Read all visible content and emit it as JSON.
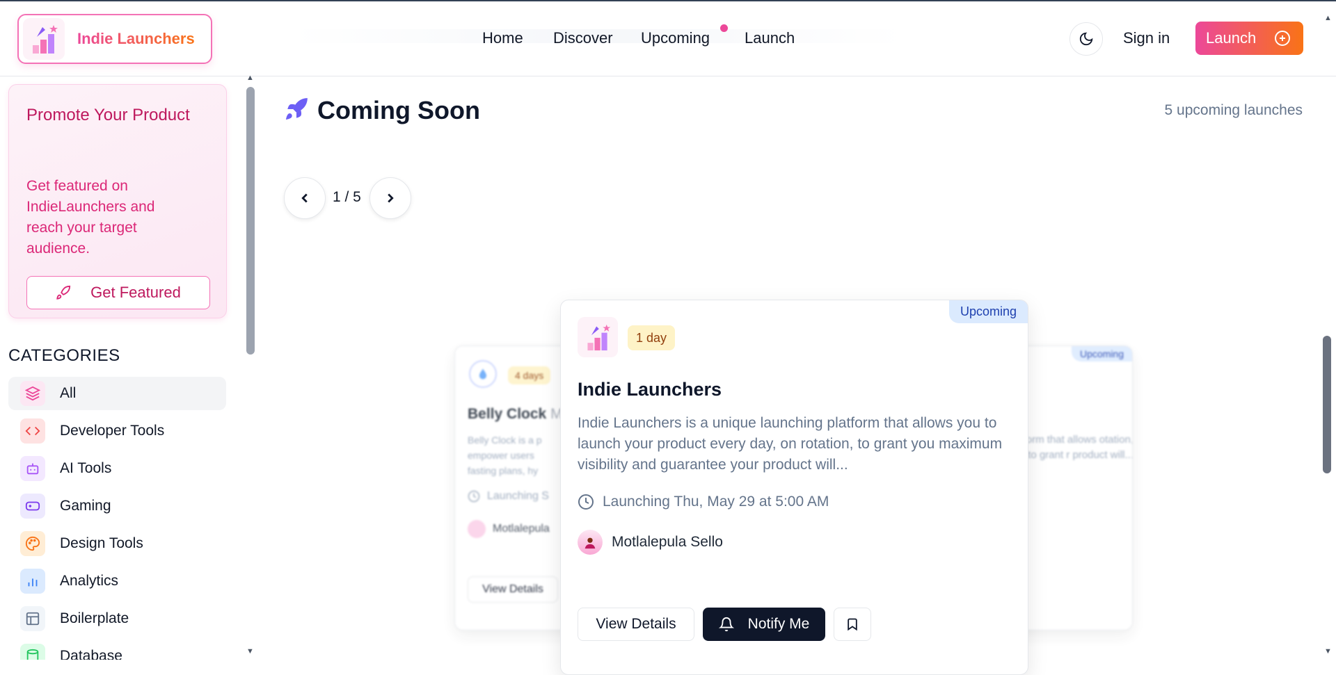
{
  "header": {
    "brand": "Indie Launchers",
    "nav": [
      "Home",
      "Discover",
      "Upcoming",
      "Launch"
    ],
    "sign_in": "Sign in",
    "launch_button": "Launch"
  },
  "sidebar": {
    "promo_title": "Promote Your Product",
    "promo_description": "Get featured on IndieLaunchers and reach your target audience.",
    "promo_button": "Get Featured",
    "categories_title": "CATEGORIES",
    "categories": [
      {
        "label": "All",
        "icon": "layers-icon",
        "color": "#ec4899"
      },
      {
        "label": "Developer Tools",
        "icon": "code-icon",
        "color": "#ef4444"
      },
      {
        "label": "AI Tools",
        "icon": "bot-icon",
        "color": "#a855f7"
      },
      {
        "label": "Gaming",
        "icon": "gamepad-icon",
        "color": "#7c3aed"
      },
      {
        "label": "Design Tools",
        "icon": "palette-icon",
        "color": "#f97316"
      },
      {
        "label": "Analytics",
        "icon": "bar-chart-icon",
        "color": "#3b82f6"
      },
      {
        "label": "Boilerplate",
        "icon": "layout-icon",
        "color": "#64748b"
      },
      {
        "label": "Database",
        "icon": "database-icon",
        "color": "#22c55e"
      }
    ]
  },
  "main": {
    "title": "Coming Soon",
    "count": "5 upcoming launches",
    "pager": "1 / 5"
  },
  "cards": {
    "center": {
      "badge": "Upcoming",
      "days": "1 day",
      "name": "Indie Launchers",
      "description": "Indie Launchers is a unique launching platform that allows you to launch your product every day, on rotation, to grant you maximum visibility and guarantee your product will...",
      "launch": "Launching Thu, May 29 at 5:00 AM",
      "author": "Motlalepula Sello",
      "view": "View Details",
      "notify": "Notify Me"
    },
    "left": {
      "days": "4 days",
      "name": "Belly Clock",
      "name_tail": "M",
      "description": "Belly Clock is a p empower users fasting plans, hy",
      "launch": "Launching S",
      "author": "Motlalepula",
      "view": "View Details"
    },
    "right": {
      "badge": "Upcoming",
      "description": "form that allows otation, to grant r product will..."
    }
  }
}
